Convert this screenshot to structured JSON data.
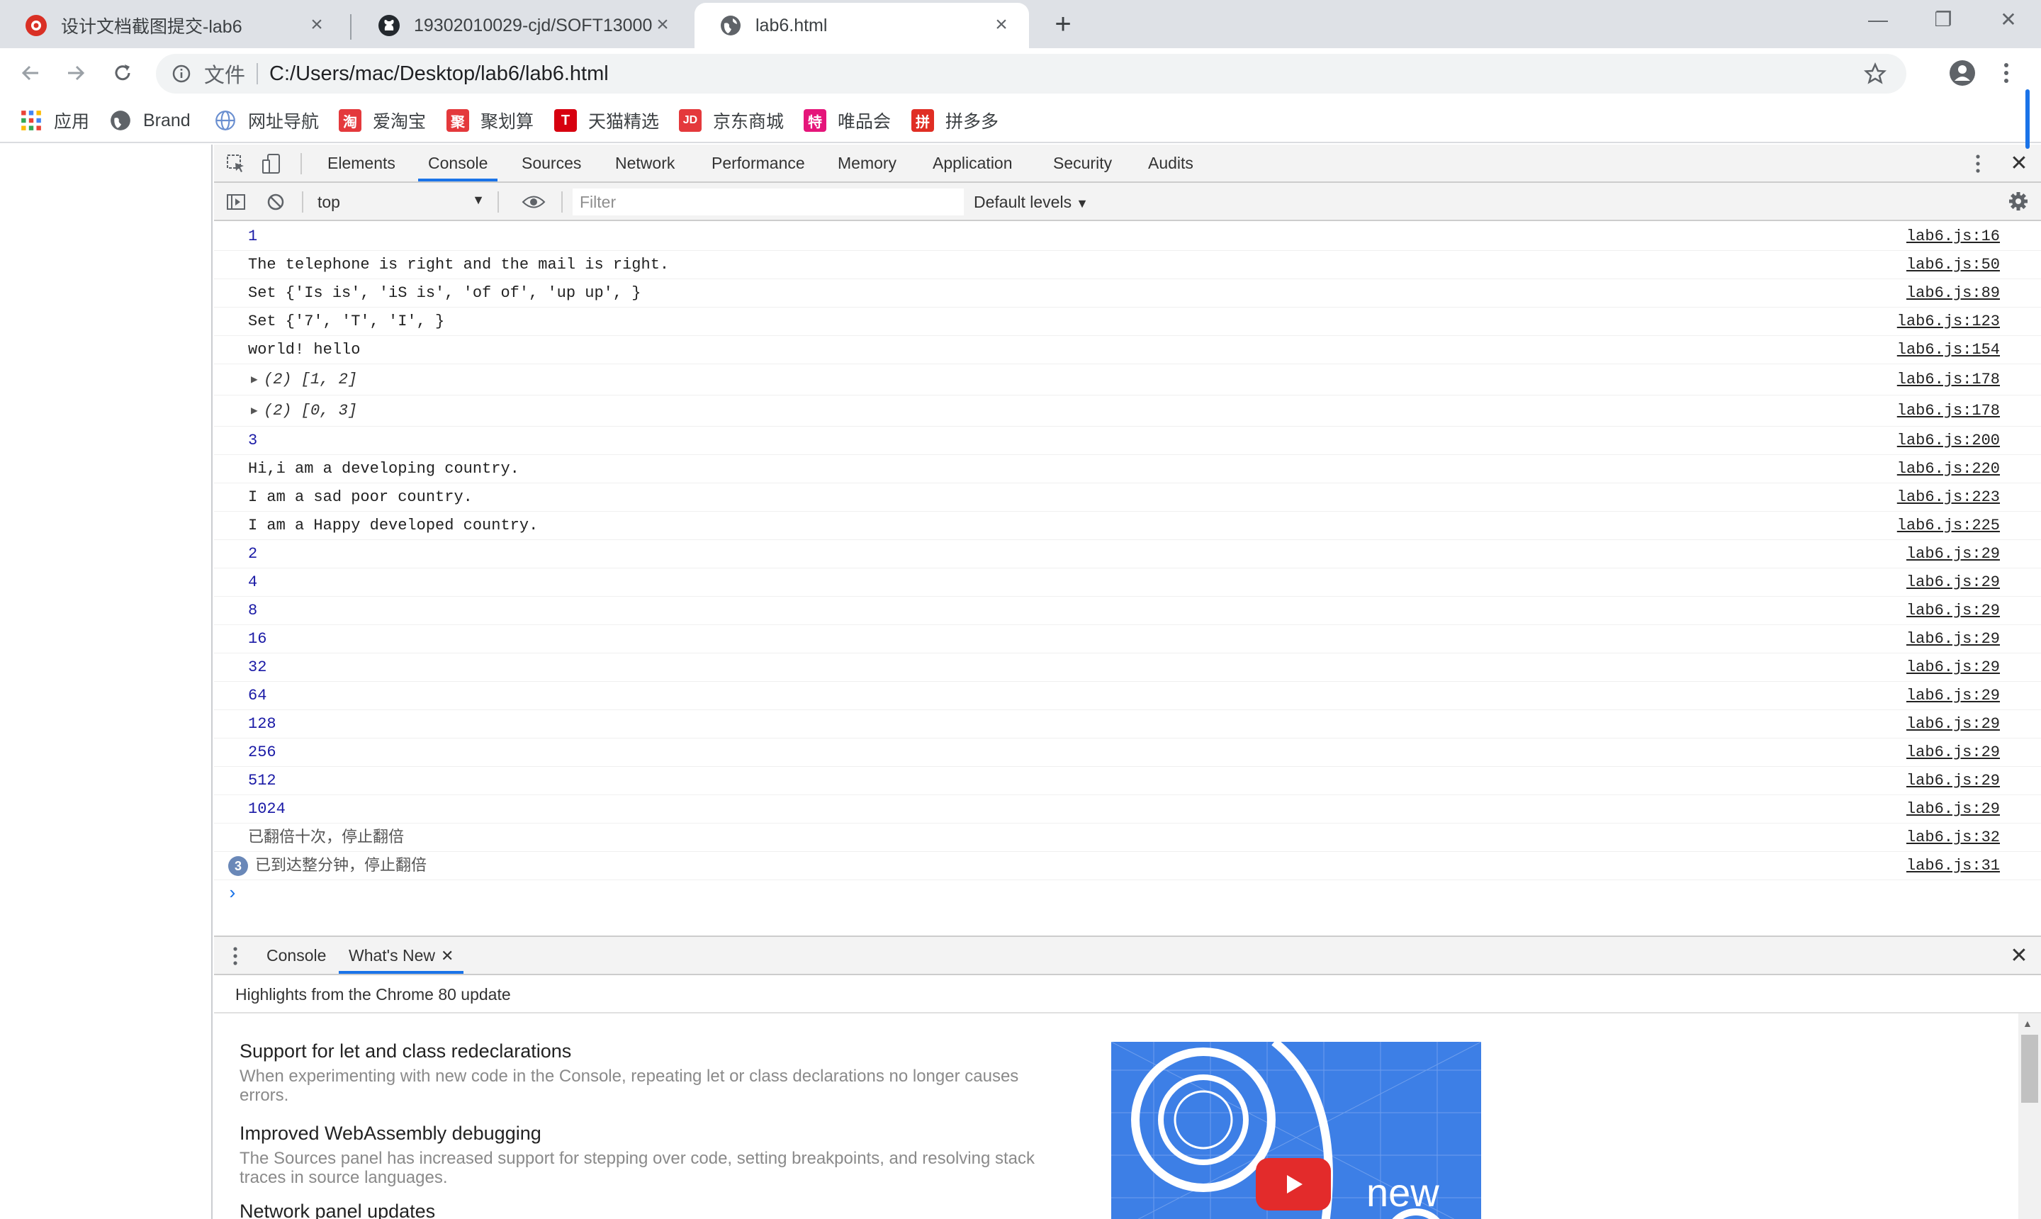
{
  "browser": {
    "tabs": [
      {
        "label": "设计文档截图提交-lab6",
        "favicon": "red-flower-icon"
      },
      {
        "label": "19302010029-cjd/SOFT13000",
        "favicon": "github-icon"
      },
      {
        "label": "lab6.html",
        "favicon": "globe-icon"
      }
    ],
    "toolbar": {
      "scheme": "文件",
      "url": "C:/Users/mac/Desktop/lab6/lab6.html"
    },
    "bookmarks": [
      {
        "label": "应用",
        "icon": "apps-grid-icon"
      },
      {
        "label": "Brand",
        "icon": "globe-icon"
      },
      {
        "label": "网址导航",
        "icon": "globe-icon"
      },
      {
        "label": "爱淘宝",
        "icon": "taobao-icon"
      },
      {
        "label": "聚划算",
        "icon": "juhuasuan-icon"
      },
      {
        "label": "天猫精选",
        "icon": "tmall-icon"
      },
      {
        "label": "京东商城",
        "icon": "jd-icon"
      },
      {
        "label": "唯品会",
        "icon": "vip-icon"
      },
      {
        "label": "拼多多",
        "icon": "pinduoduo-icon"
      }
    ]
  },
  "devtools": {
    "tabs": [
      "Elements",
      "Console",
      "Sources",
      "Network",
      "Performance",
      "Memory",
      "Application",
      "Security",
      "Audits"
    ],
    "active_tab": "Console",
    "console_toolbar": {
      "context": "top",
      "filter_placeholder": "Filter",
      "levels": "Default levels"
    },
    "log": [
      {
        "text": "1",
        "kind": "number",
        "source": "lab6.js:16"
      },
      {
        "text": "The telephone is right and the mail is right.",
        "kind": "text",
        "source": "lab6.js:50"
      },
      {
        "text": "Set {'Is is', 'iS is', 'of of', 'up up', }",
        "kind": "text",
        "source": "lab6.js:89"
      },
      {
        "text": "Set {'7', 'T', 'I', }",
        "kind": "text",
        "source": "lab6.js:123"
      },
      {
        "text": "world! hello",
        "kind": "text",
        "source": "lab6.js:154"
      },
      {
        "text": "(2) [1, 2]",
        "kind": "array",
        "source": "lab6.js:178"
      },
      {
        "text": "(2) [0, 3]",
        "kind": "array",
        "source": "lab6.js:178"
      },
      {
        "text": "3",
        "kind": "number",
        "source": "lab6.js:200"
      },
      {
        "text": "Hi,i am a developing country.",
        "kind": "text",
        "source": "lab6.js:220"
      },
      {
        "text": "I am a sad poor country.",
        "kind": "text",
        "source": "lab6.js:223"
      },
      {
        "text": "I am a Happy developed country.",
        "kind": "text",
        "source": "lab6.js:225"
      },
      {
        "text": "2",
        "kind": "number",
        "source": "lab6.js:29"
      },
      {
        "text": "4",
        "kind": "number",
        "source": "lab6.js:29"
      },
      {
        "text": "8",
        "kind": "number",
        "source": "lab6.js:29"
      },
      {
        "text": "16",
        "kind": "number",
        "source": "lab6.js:29"
      },
      {
        "text": "32",
        "kind": "number",
        "source": "lab6.js:29"
      },
      {
        "text": "64",
        "kind": "number",
        "source": "lab6.js:29"
      },
      {
        "text": "128",
        "kind": "number",
        "source": "lab6.js:29"
      },
      {
        "text": "256",
        "kind": "number",
        "source": "lab6.js:29"
      },
      {
        "text": "512",
        "kind": "number",
        "source": "lab6.js:29"
      },
      {
        "text": "1024",
        "kind": "number",
        "source": "lab6.js:29"
      },
      {
        "text": "已翻倍十次，停止翻倍",
        "kind": "cjk",
        "source": "lab6.js:32"
      },
      {
        "text": "已到达整分钟，停止翻倍",
        "kind": "cjk",
        "source": "lab6.js:31",
        "repeat": "3"
      }
    ],
    "drawer": {
      "tabs": [
        "Console",
        "What's New"
      ],
      "active_tab": "What's New",
      "header": "Highlights from the Chrome 80 update",
      "features": [
        {
          "title": "Support for let and class redeclarations",
          "desc": "When experimenting with new code in the Console, repeating let or class declarations no longer causes errors."
        },
        {
          "title": "Improved WebAssembly debugging",
          "desc": "The Sources panel has increased support for stepping over code, setting breakpoints, and resolving stack traces in source languages."
        },
        {
          "title": "Network panel updates",
          "desc": ""
        }
      ],
      "promo_text": "new"
    }
  }
}
